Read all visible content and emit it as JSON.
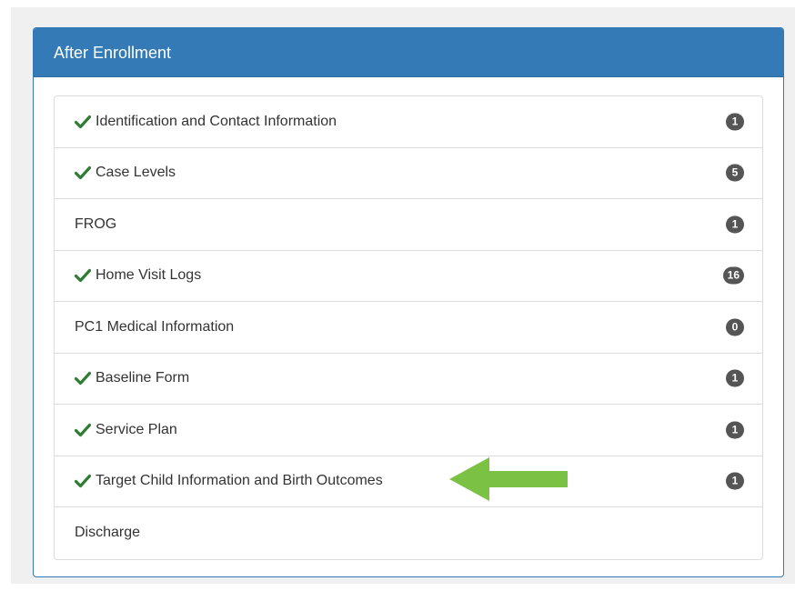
{
  "panel": {
    "title": "After Enrollment"
  },
  "items": [
    {
      "label": "Identification and Contact Information",
      "checked": true,
      "badge": "1"
    },
    {
      "label": "Case Levels",
      "checked": true,
      "badge": "5"
    },
    {
      "label": "FROG",
      "checked": false,
      "badge": "1"
    },
    {
      "label": "Home Visit Logs",
      "checked": true,
      "badge": "16"
    },
    {
      "label": "PC1 Medical Information",
      "checked": false,
      "badge": "0"
    },
    {
      "label": "Baseline Form",
      "checked": true,
      "badge": "1"
    },
    {
      "label": "Service Plan",
      "checked": true,
      "badge": "1"
    },
    {
      "label": "Target Child Information and Birth Outcomes",
      "checked": true,
      "badge": "1"
    },
    {
      "label": "Discharge",
      "checked": false,
      "badge": ""
    }
  ],
  "colors": {
    "heading": "#337ab7",
    "check": "#2e7d32",
    "badge": "#555555",
    "arrow": "#7bc143"
  },
  "icons": {
    "check": "checkmark-icon",
    "annotation": "left-arrow-icon"
  }
}
